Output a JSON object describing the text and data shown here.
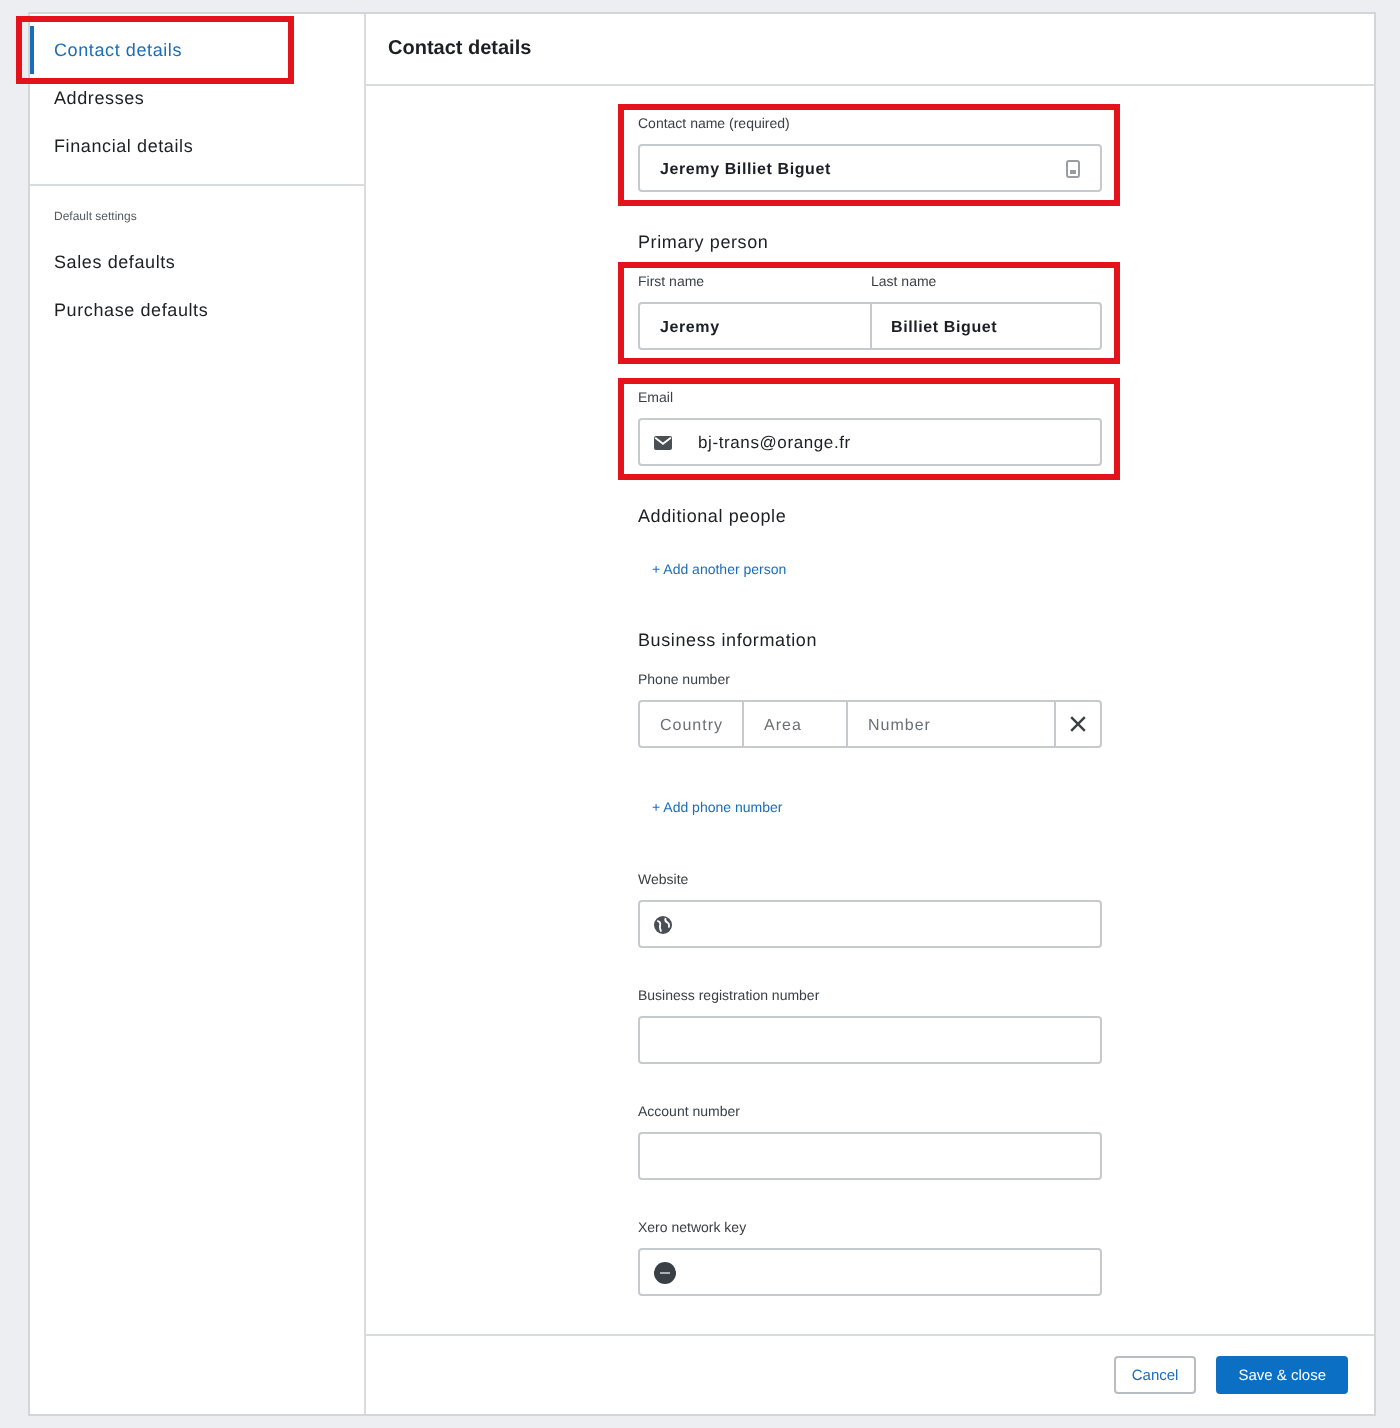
{
  "sidebar": {
    "items": [
      {
        "label": "Contact details",
        "selected": true,
        "highlighted": true
      },
      {
        "label": "Addresses",
        "selected": false,
        "highlighted": false
      },
      {
        "label": "Financial details",
        "selected": false,
        "highlighted": false
      }
    ],
    "section_label": "Default settings",
    "section_items": [
      {
        "label": "Sales defaults",
        "selected": false
      },
      {
        "label": "Purchase defaults",
        "selected": false
      }
    ]
  },
  "header": {
    "title": "Contact details"
  },
  "form": {
    "blocks": [
      {
        "kind": "name",
        "label": "Contact name (required)",
        "value": "Jeremy Billiet Biguet",
        "highlighted": true
      },
      {
        "kind": "heading",
        "text": "Primary person"
      },
      {
        "kind": "pair",
        "highlighted": true,
        "fields": [
          {
            "label": "First name",
            "value": "Jeremy"
          },
          {
            "label": "Last name",
            "value": "Billiet Biguet"
          }
        ]
      },
      {
        "kind": "email",
        "label": "Email",
        "value": "bj-trans@orange.fr",
        "highlighted": true
      },
      {
        "kind": "heading",
        "text": "Additional people"
      },
      {
        "kind": "link",
        "text": "+ Add another person"
      },
      {
        "kind": "heading",
        "text": "Business information"
      },
      {
        "kind": "phone",
        "label": "Phone number",
        "parts": [
          {
            "placeholder": "Country"
          },
          {
            "placeholder": "Area"
          },
          {
            "placeholder": "Number"
          }
        ]
      },
      {
        "kind": "link",
        "text": "+ Add phone number"
      },
      {
        "kind": "website",
        "label": "Website",
        "highlighted": false
      },
      {
        "kind": "plain",
        "label": "Business registration number",
        "highlighted": false
      },
      {
        "kind": "plain",
        "label": "Account number",
        "highlighted": false
      },
      {
        "kind": "key",
        "label": "Xero network key",
        "highlighted": false
      }
    ]
  },
  "footer": {
    "buttons": [
      {
        "label": "Cancel",
        "kind": "secondary"
      },
      {
        "label": "Save & close",
        "kind": "primary"
      }
    ]
  }
}
